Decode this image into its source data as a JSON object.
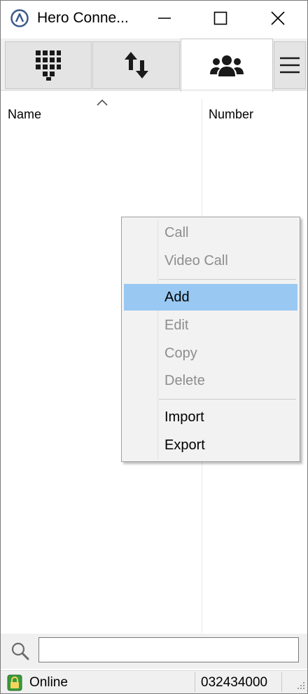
{
  "window": {
    "title": "Hero Conne...",
    "controls": {
      "minimize": "minimize-icon",
      "maximize": "maximize-icon",
      "close": "close-icon"
    }
  },
  "toolbar": {
    "tabs": [
      {
        "name": "dialpad",
        "icon": "dialpad-icon"
      },
      {
        "name": "transfer",
        "icon": "transfer-arrows-icon"
      },
      {
        "name": "contacts",
        "icon": "contacts-group-icon",
        "selected": true
      },
      {
        "name": "menu",
        "icon": "hamburger-menu-icon"
      }
    ]
  },
  "list": {
    "columns": [
      "Name",
      "Number"
    ],
    "sort_indicator": "caret-up-icon",
    "rows": []
  },
  "context_menu": {
    "items": [
      {
        "label": "Call",
        "enabled": false
      },
      {
        "label": "Video Call",
        "enabled": false
      },
      {
        "label": "Add",
        "enabled": true,
        "highlighted": true
      },
      {
        "label": "Edit",
        "enabled": false
      },
      {
        "label": "Copy",
        "enabled": false
      },
      {
        "label": "Delete",
        "enabled": false
      },
      {
        "label": "Import",
        "enabled": true
      },
      {
        "label": "Export",
        "enabled": true
      }
    ]
  },
  "search": {
    "value": "",
    "placeholder": ""
  },
  "status": {
    "state": "Online",
    "number": "032434000"
  },
  "colors": {
    "highlight": "#99c9f2",
    "disabled_text": "#8d8d8d",
    "toolbar_bg": "#f0f0f0",
    "status_icon_green": "#3a9a3a"
  }
}
